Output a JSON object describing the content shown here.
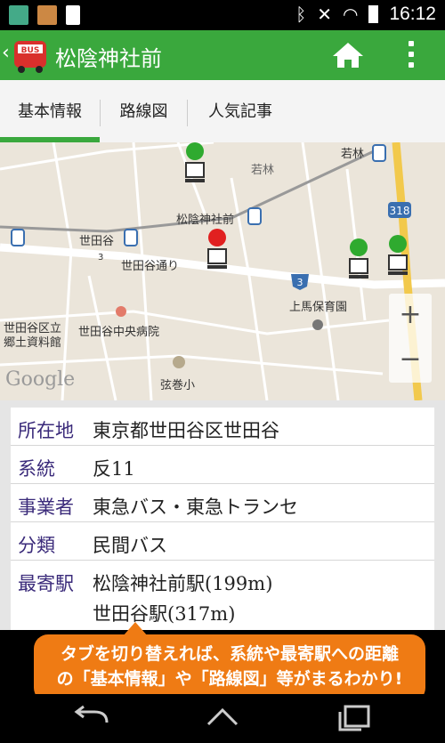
{
  "status_bar": {
    "time": "16:12"
  },
  "app_bar": {
    "title": "松陰神社前",
    "app_icon_text": "BUS"
  },
  "tabs": [
    {
      "label": "基本情報",
      "active": true
    },
    {
      "label": "路線図",
      "active": false
    },
    {
      "label": "人気記事",
      "active": false
    }
  ],
  "map": {
    "labels": {
      "wakabayashi_station": "若林",
      "wakabayashi_area": "若林",
      "shoin_station": "松陰神社前",
      "setagaya_station": "世田谷",
      "setagaya_dori": "世田谷通り",
      "route_3": "3",
      "route_318": "318",
      "route_3_small": "3",
      "kamiuma_nursery": "上馬保育園",
      "museum_line1": "世田谷区立",
      "museum_line2": "郷土資料館",
      "hospital": "世田谷中央病院",
      "school": "弦巻小",
      "google": "Google"
    }
  },
  "info": {
    "rows": [
      {
        "key": "所在地",
        "value": "東京都世田谷区世田谷"
      },
      {
        "key": "系統",
        "value": "反11"
      },
      {
        "key": "事業者",
        "value": "東急バス・東急トランセ"
      },
      {
        "key": "分類",
        "value": "民間バス"
      },
      {
        "key": "最寄駅",
        "value": "松陰神社前駅(199m)",
        "value2": "世田谷駅(317m)"
      }
    ]
  },
  "banner": {
    "line1": "タブを切り替えれば、系統や最寄駅への距離",
    "line2": "の「基本情報」や「路線図」等がまるわかり!"
  },
  "colors": {
    "accent": "#3aa83d",
    "banner": "#ef7b14",
    "label": "#3a2a7a"
  }
}
